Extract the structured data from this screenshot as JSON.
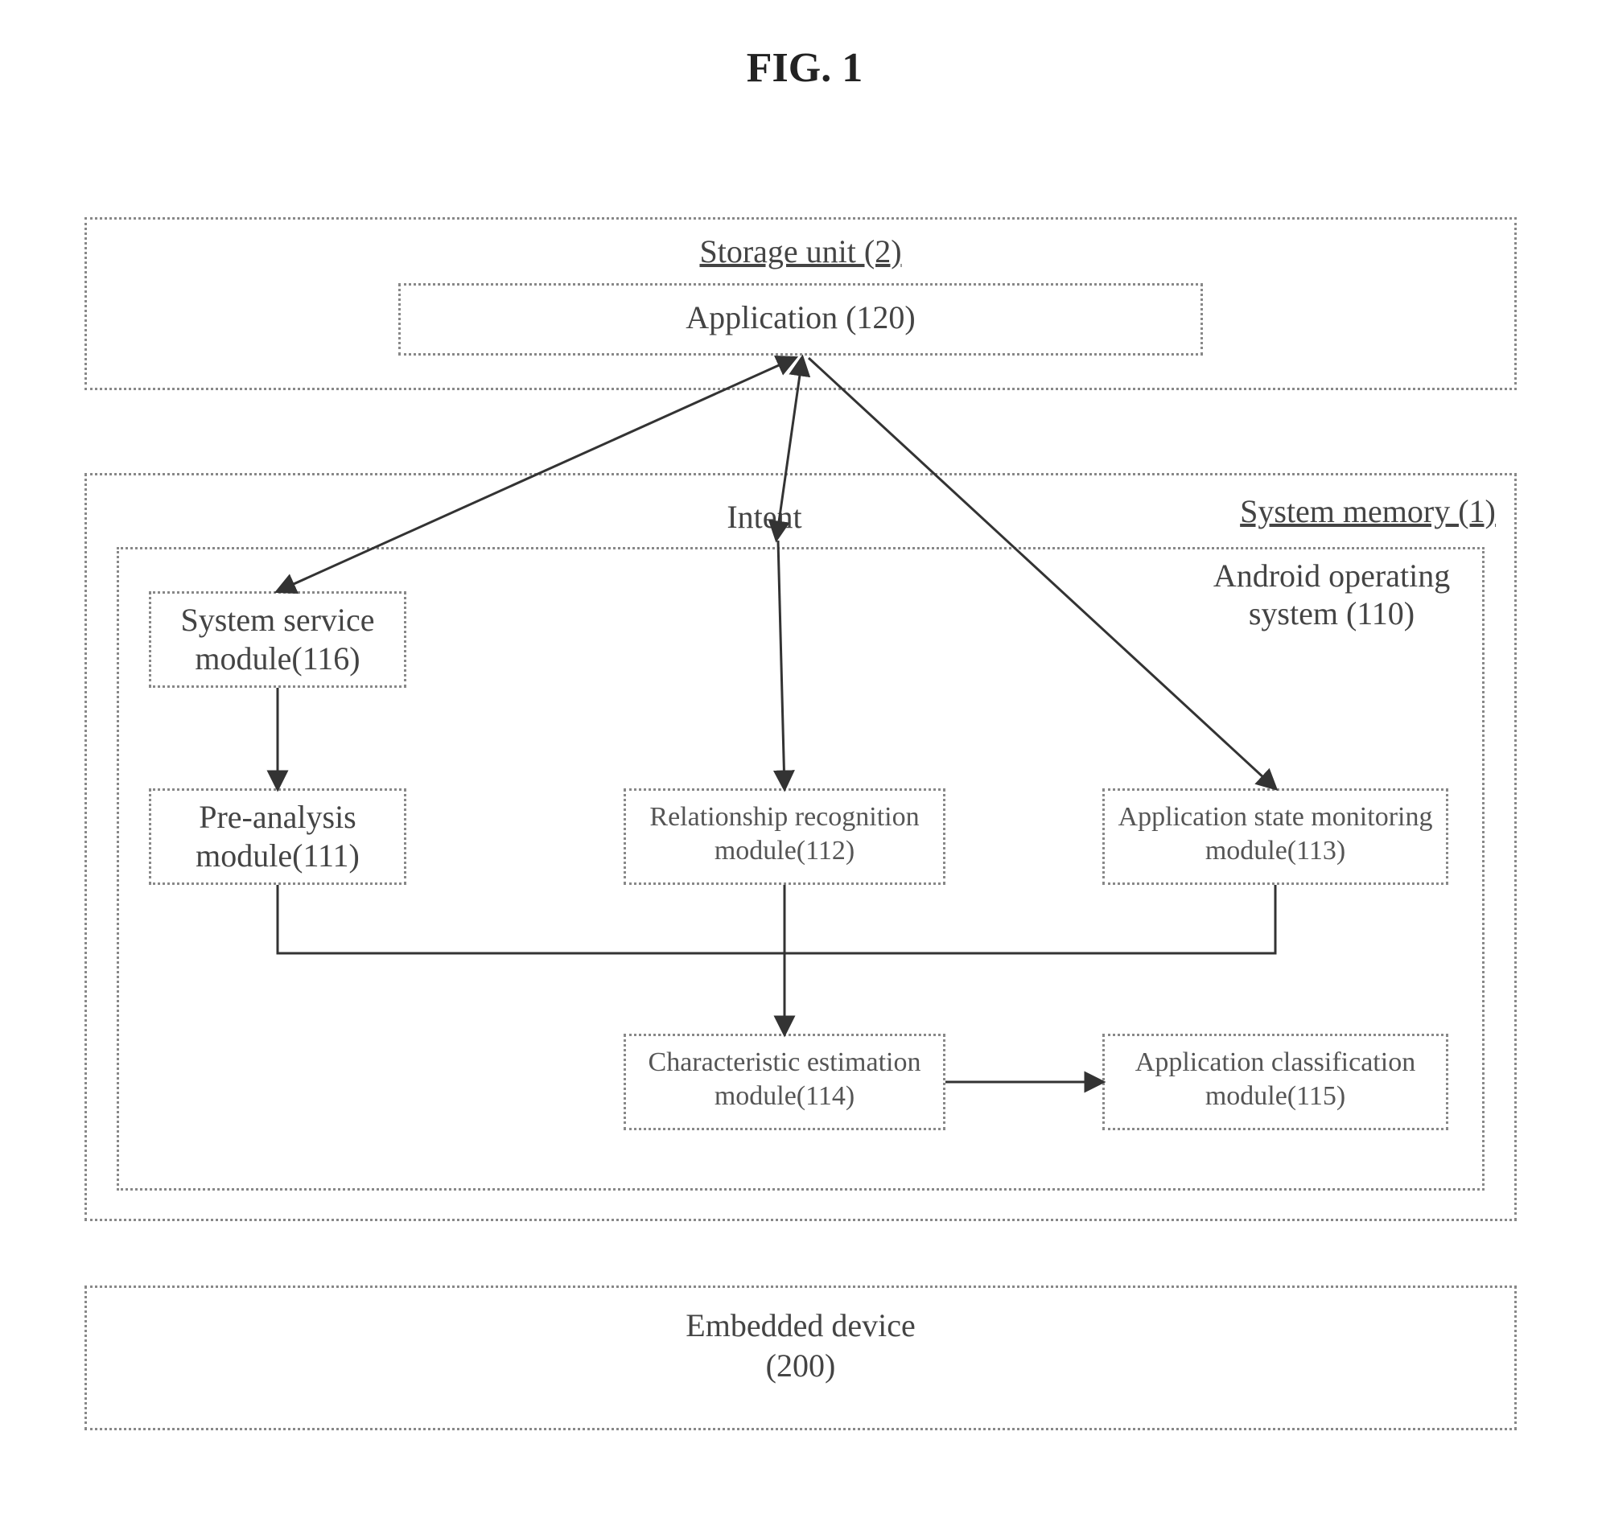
{
  "figure_title": "FIG. 1",
  "storage_unit": {
    "title": "Storage unit (2)",
    "application": "Application (120)"
  },
  "intent_label": "Intent",
  "system_memory": {
    "title": "System memory (1)",
    "os": {
      "title_line1": "Android operating",
      "title_line2": "system (110)"
    },
    "modules": {
      "system_service": {
        "line1": "System service",
        "line2": "module(116)"
      },
      "pre_analysis": {
        "line1": "Pre-analysis",
        "line2": "module(111)"
      },
      "relationship": {
        "line1": "Relationship recognition",
        "line2": "module(112)"
      },
      "app_state_monitor": {
        "line1": "Application state monitoring",
        "line2": "module(113)"
      },
      "characteristic": {
        "line1": "Characteristic estimation",
        "line2": "module(114)"
      },
      "app_classification": {
        "line1": "Application classification",
        "line2": "module(115)"
      }
    }
  },
  "embedded_device": {
    "line1": "Embedded device",
    "line2": "(200)"
  }
}
